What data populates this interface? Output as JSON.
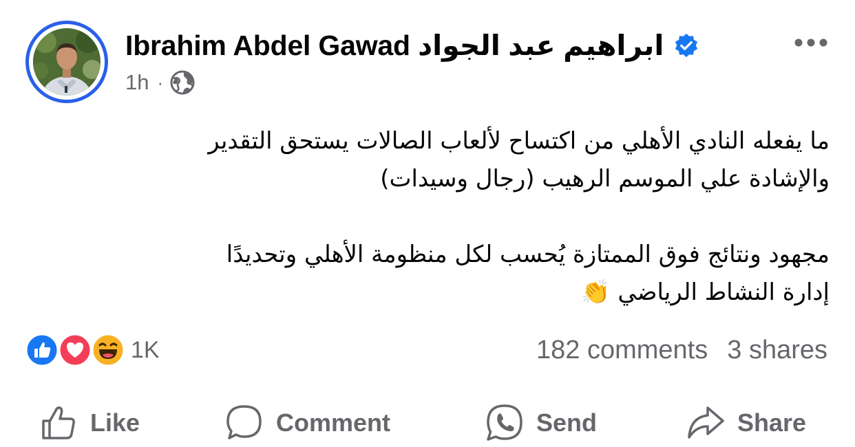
{
  "post": {
    "author_name": "Ibrahim Abdel Gawad ابراهيم  عبد  الجواد",
    "time": "1h",
    "separator": "·",
    "audience_icon": "globe-icon",
    "verified_icon": "verified-badge-icon",
    "more_icon": "more-options-icon",
    "body": {
      "paragraph1_line1": "ما يفعله النادي الأهلي من اكتساح لألعاب الصالات يستحق التقدير",
      "paragraph1_line2": "والإشادة علي الموسم الرهيب (رجال وسيدات)",
      "paragraph2_line1": "مجهود ونتائج فوق الممتازة يُحسب لكل منظومة الأهلي وتحديدًا",
      "paragraph2_line2": "إدارة النشاط الرياضي",
      "emoji": "👏"
    }
  },
  "reactions": {
    "icons": [
      "like-reaction-icon",
      "love-reaction-icon",
      "haha-reaction-icon"
    ],
    "count": "1K"
  },
  "stats": {
    "comments": "182 comments",
    "shares": "3 shares"
  },
  "actions": {
    "like": "Like",
    "comment": "Comment",
    "send": "Send",
    "share": "Share"
  },
  "colors": {
    "accent": "#1877f2",
    "avatar_ring": "#2a5fe8",
    "secondary_text": "#65676b",
    "love": "#f33e58",
    "haha": "#f7b125"
  }
}
